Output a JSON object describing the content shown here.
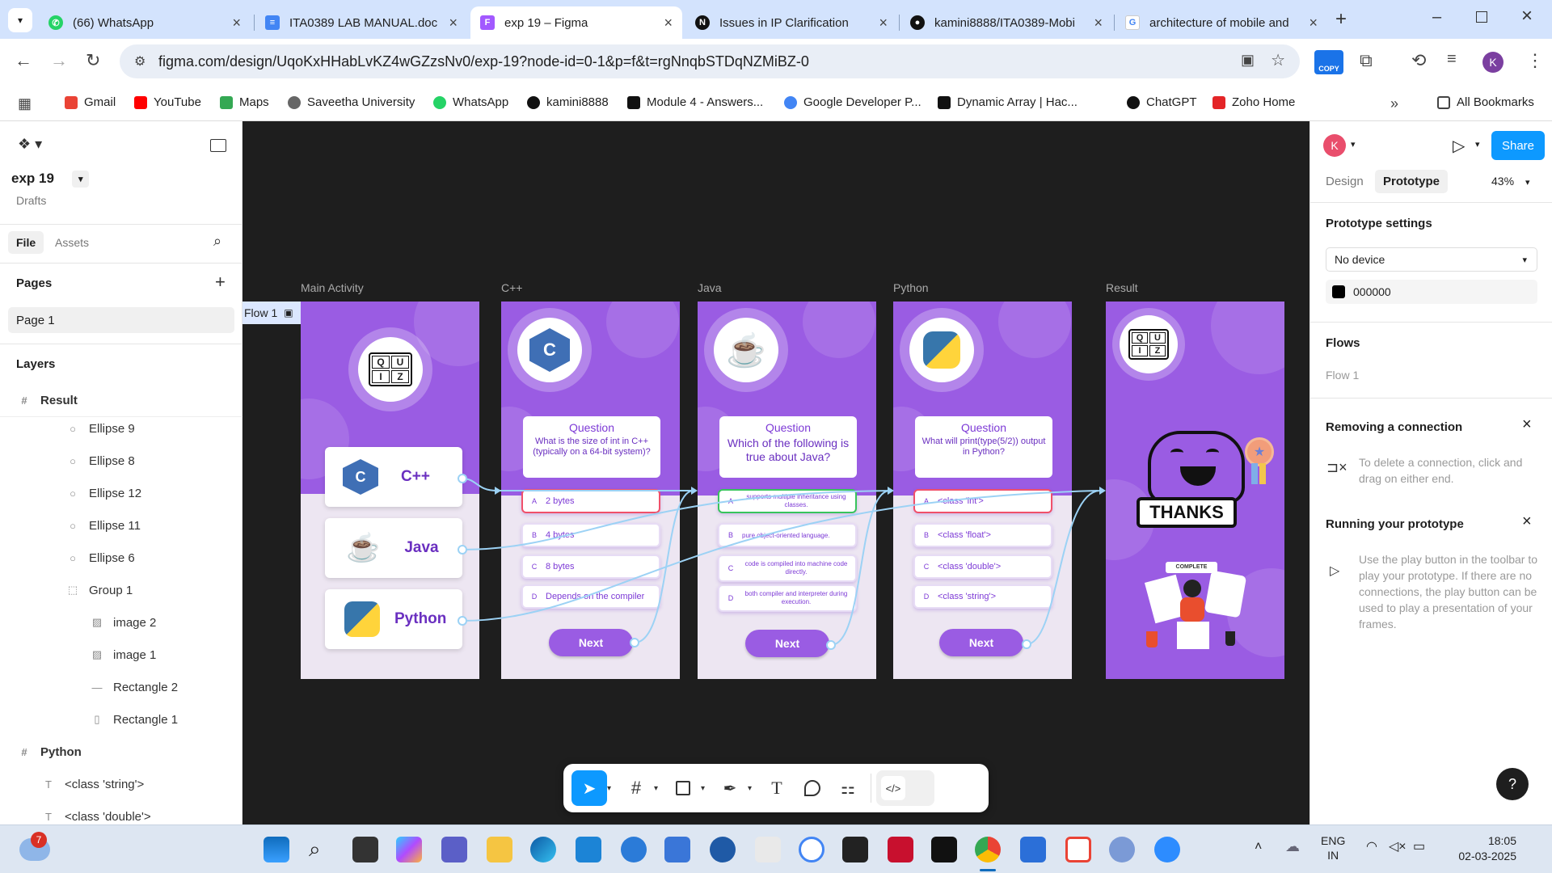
{
  "browser": {
    "tabs": [
      {
        "title": "(66) WhatsApp",
        "icon": "whatsapp-icon",
        "color": "#25d366"
      },
      {
        "title": "ITA0389 LAB MANUAL.doc",
        "icon": "docs-icon",
        "color": "#4285f4"
      },
      {
        "title": "exp 19 – Figma",
        "icon": "figma-icon",
        "color": "#a259ff"
      },
      {
        "title": "Issues in IP Clarification",
        "icon": "notion-icon",
        "color": "#111111"
      },
      {
        "title": "kamini8888/ITA0389-Mobi",
        "icon": "github-icon",
        "color": "#111111"
      },
      {
        "title": "architecture of mobile and",
        "icon": "google-icon",
        "color": "#4285f4"
      }
    ],
    "url": "figma.com/design/UqoKxHHabLvKZ4wGZzsNv0/exp-19?node-id=0-1&p=f&t=rgNnqbSTDqNZMiBZ-0",
    "copy_badge": "COPY",
    "avatar_letter": "K",
    "bookmarks": [
      {
        "label": "Gmail",
        "icon": "gmail-icon",
        "color": "#ea4335"
      },
      {
        "label": "YouTube",
        "icon": "youtube-icon",
        "color": "#ff0000"
      },
      {
        "label": "Maps",
        "icon": "maps-icon",
        "color": "#34a853"
      },
      {
        "label": "Saveetha University",
        "icon": "globe-icon",
        "color": "#666666"
      },
      {
        "label": "WhatsApp",
        "icon": "whatsapp-icon",
        "color": "#25d366"
      },
      {
        "label": "kamini8888",
        "icon": "github-icon",
        "color": "#111111"
      },
      {
        "label": "Module 4 - Answers...",
        "icon": "notion-icon",
        "color": "#111111"
      },
      {
        "label": "Google Developer P...",
        "icon": "google-icon",
        "color": "#4285f4"
      },
      {
        "label": "Dynamic Array | Hac...",
        "icon": "hackerrank-icon",
        "color": "#111111"
      },
      {
        "label": "ChatGPT",
        "icon": "chatgpt-icon",
        "color": "#111111"
      },
      {
        "label": "Zoho Home",
        "icon": "zoho-icon",
        "color": "#e42527"
      }
    ],
    "all_bookmarks": "All Bookmarks"
  },
  "figma": {
    "file_name": "exp 19",
    "drafts": "Drafts",
    "left_tabs": [
      "File",
      "Assets"
    ],
    "pages_title": "Pages",
    "page": "Page 1",
    "layers_title": "Layers",
    "layers": [
      {
        "name": "Result",
        "type": "frame",
        "indent": 0
      },
      {
        "name": "Ellipse 9",
        "type": "ellipse",
        "indent": 1
      },
      {
        "name": "Ellipse 8",
        "type": "ellipse",
        "indent": 1
      },
      {
        "name": "Ellipse 12",
        "type": "ellipse",
        "indent": 1
      },
      {
        "name": "Ellipse 11",
        "type": "ellipse",
        "indent": 1
      },
      {
        "name": "Ellipse 6",
        "type": "ellipse",
        "indent": 1
      },
      {
        "name": "Group 1",
        "type": "group",
        "indent": 1
      },
      {
        "name": "image 2",
        "type": "image",
        "indent": 2
      },
      {
        "name": "image 1",
        "type": "image",
        "indent": 2
      },
      {
        "name": "Rectangle 2",
        "type": "line",
        "indent": 2
      },
      {
        "name": "Rectangle 1",
        "type": "rect",
        "indent": 2
      },
      {
        "name": "Python",
        "type": "frame",
        "indent": 0
      },
      {
        "name": "<class 'string'>",
        "type": "text",
        "indent": 1
      },
      {
        "name": "<class 'double'>",
        "type": "text",
        "indent": 1
      }
    ],
    "right": {
      "tabs": [
        "Design",
        "Prototype"
      ],
      "zoom": "43%",
      "share": "Share",
      "avatar_letter": "K",
      "proto_settings": "Prototype settings",
      "device": "No device",
      "bg_color": "000000",
      "flows_title": "Flows",
      "flow": "Flow 1",
      "removing_title": "Removing a connection",
      "removing_text": "To delete a connection, click and drag on either end.",
      "running_title": "Running your prototype",
      "running_text": "Use the play button in the toolbar to play your prototype. If there are no connections, the play button can be used to play a presentation of your frames.",
      "help": "?"
    },
    "canvas": {
      "flow_tag": "Flow 1",
      "frames": [
        {
          "label": "Main Activity"
        },
        {
          "label": "C++",
          "question": "Question",
          "text": "What is the size of int in C++ (typically on a 64-bit system)?",
          "options": [
            {
              "letter": "A",
              "text": "2 bytes"
            },
            {
              "letter": "B",
              "text": "4 bytes"
            },
            {
              "letter": "C",
              "text": "8 bytes"
            },
            {
              "letter": "D",
              "text": "Depends on the compiler"
            }
          ],
          "next": "Next"
        },
        {
          "label": "Java",
          "question": "Question",
          "text": "Which of the following is true about Java?",
          "options": [
            {
              "letter": "A",
              "text": "supports multiple inheritance using classes."
            },
            {
              "letter": "B",
              "text": "pure object-oriented language."
            },
            {
              "letter": "C",
              "text": "code is compiled into machine code directly."
            },
            {
              "letter": "D",
              "text": "both compiler and interpreter during execution."
            }
          ],
          "next": "Next"
        },
        {
          "label": "Python",
          "question": "Question",
          "text": "What will print(type(5/2)) output in Python?",
          "options": [
            {
              "letter": "A",
              "text": "<class 'int'>"
            },
            {
              "letter": "B",
              "text": "<class 'float'>"
            },
            {
              "letter": "C",
              "text": "<class 'double'>"
            },
            {
              "letter": "D",
              "text": "<class 'string'>"
            }
          ],
          "next": "Next"
        },
        {
          "label": "Result",
          "thanks": "THANKS",
          "complete": "COMPLETE"
        }
      ],
      "main_buttons": [
        "C++",
        "Java",
        "Python"
      ],
      "quiz_letters": [
        "Q",
        "U",
        "I",
        "Z"
      ]
    }
  },
  "taskbar": {
    "weather_badge": "7",
    "lang": "ENG",
    "region": "IN",
    "time": "18:05",
    "date": "02-03-2025"
  }
}
